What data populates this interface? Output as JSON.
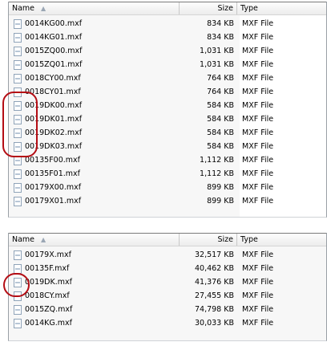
{
  "columns": {
    "name": "Name",
    "size": "Size",
    "type": "Type"
  },
  "top_files": [
    {
      "name": "0014KG00.mxf",
      "size": "834 KB",
      "type": "MXF File"
    },
    {
      "name": "0014KG01.mxf",
      "size": "834 KB",
      "type": "MXF File"
    },
    {
      "name": "0015ZQ00.mxf",
      "size": "1,031 KB",
      "type": "MXF File"
    },
    {
      "name": "0015ZQ01.mxf",
      "size": "1,031 KB",
      "type": "MXF File"
    },
    {
      "name": "0018CY00.mxf",
      "size": "764 KB",
      "type": "MXF File"
    },
    {
      "name": "0018CY01.mxf",
      "size": "764 KB",
      "type": "MXF File"
    },
    {
      "name": "0019DK00.mxf",
      "size": "584 KB",
      "type": "MXF File"
    },
    {
      "name": "0019DK01.mxf",
      "size": "584 KB",
      "type": "MXF File"
    },
    {
      "name": "0019DK02.mxf",
      "size": "584 KB",
      "type": "MXF File"
    },
    {
      "name": "0019DK03.mxf",
      "size": "584 KB",
      "type": "MXF File"
    },
    {
      "name": "00135F00.mxf",
      "size": "1,112 KB",
      "type": "MXF File"
    },
    {
      "name": "00135F01.mxf",
      "size": "1,112 KB",
      "type": "MXF File"
    },
    {
      "name": "00179X00.mxf",
      "size": "899 KB",
      "type": "MXF File"
    },
    {
      "name": "00179X01.mxf",
      "size": "899 KB",
      "type": "MXF File"
    }
  ],
  "bottom_files": [
    {
      "name": "00179X.mxf",
      "size": "32,517 KB",
      "type": "MXF File"
    },
    {
      "name": "00135F.mxf",
      "size": "40,462 KB",
      "type": "MXF File"
    },
    {
      "name": "0019DK.mxf",
      "size": "41,376 KB",
      "type": "MXF File"
    },
    {
      "name": "0018CY.mxf",
      "size": "27,455 KB",
      "type": "MXF File"
    },
    {
      "name": "0015ZQ.mxf",
      "size": "74,798 KB",
      "type": "MXF File"
    },
    {
      "name": "0014KG.mxf",
      "size": "30,033 KB",
      "type": "MXF File"
    }
  ],
  "icons": {
    "file": "mxf-file-icon",
    "sort": "sort-ascending-icon"
  },
  "colors": {
    "highlight": "#b40d14"
  }
}
